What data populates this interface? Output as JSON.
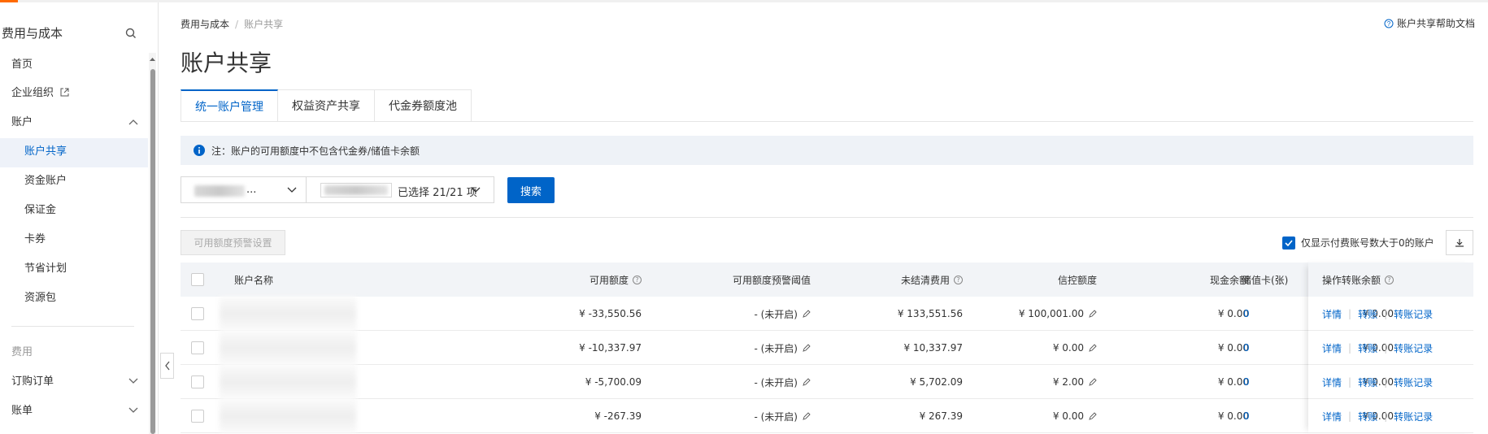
{
  "sidebar": {
    "title": "费用与成本",
    "items": [
      {
        "label": "首页"
      },
      {
        "label": "企业组织"
      },
      {
        "label": "账户"
      },
      {
        "label": "账户共享"
      },
      {
        "label": "资金账户"
      },
      {
        "label": "保证金"
      },
      {
        "label": "卡券"
      },
      {
        "label": "节省计划"
      },
      {
        "label": "资源包"
      },
      {
        "label": "费用"
      },
      {
        "label": "订购订单"
      },
      {
        "label": "账单"
      }
    ]
  },
  "breadcrumb": {
    "root": "费用与成本",
    "separator": "/",
    "current": "账户共享"
  },
  "help_link": "账户共享帮助文档",
  "page_title": "账户共享",
  "tabs": [
    {
      "label": "统一账户管理",
      "active": true
    },
    {
      "label": "权益资产共享",
      "active": false
    },
    {
      "label": "代金券额度池",
      "active": false
    }
  ],
  "notice": "注：账户的可用额度中不包含代金券/储值卡余额",
  "filters": {
    "select1_suffix": "...",
    "select2_selected": "已选择 21/21 项",
    "search_button": "搜索"
  },
  "toolbar": {
    "alert_setting_button": "可用额度预警设置",
    "only_nonzero_label": "仅显示付费账号数大于0的账户",
    "only_nonzero_checked": true
  },
  "table": {
    "headers": {
      "name": "账户名称",
      "available": "可用额度",
      "threshold": "可用额度预警阈值",
      "unsettled": "未结清费用",
      "credit": "信控额度",
      "cash": "现金余额",
      "transfer": "转账余额",
      "card": "储值卡(张)",
      "ops": "操作"
    },
    "rows": [
      {
        "available": "¥ -33,550.56",
        "threshold": "- (未开启)",
        "unsettled": "¥ 133,551.56",
        "credit": "¥ 100,001.00",
        "cash": "¥ 0.00",
        "transfer": "¥ 0.00",
        "card": "0"
      },
      {
        "available": "¥ -10,337.97",
        "threshold": "- (未开启)",
        "unsettled": "¥ 10,337.97",
        "credit": "¥ 0.00",
        "cash": "¥ 0.00",
        "transfer": "¥ 0.00",
        "card": "0"
      },
      {
        "available": "¥ -5,700.09",
        "threshold": "- (未开启)",
        "unsettled": "¥ 5,702.09",
        "credit": "¥ 2.00",
        "cash": "¥ 0.00",
        "transfer": "¥ 0.00",
        "card": "0"
      },
      {
        "available": "¥ -267.39",
        "threshold": "- (未开启)",
        "unsettled": "¥ 267.39",
        "credit": "¥ 0.00",
        "cash": "¥ 0.00",
        "transfer": "¥ 0.00",
        "card": "0"
      }
    ],
    "ops": {
      "detail": "详情",
      "transfer": "转账",
      "records": "转账记录"
    }
  },
  "colors": {
    "accent": "#0064c8",
    "brand_orange": "#ff6a00"
  },
  "icons": [
    "search-icon",
    "external-link-icon",
    "chevron-up-icon",
    "chevron-down-icon",
    "info-icon",
    "help-circle-icon",
    "edit-icon",
    "download-icon",
    "collapse-left-icon",
    "check-icon"
  ]
}
